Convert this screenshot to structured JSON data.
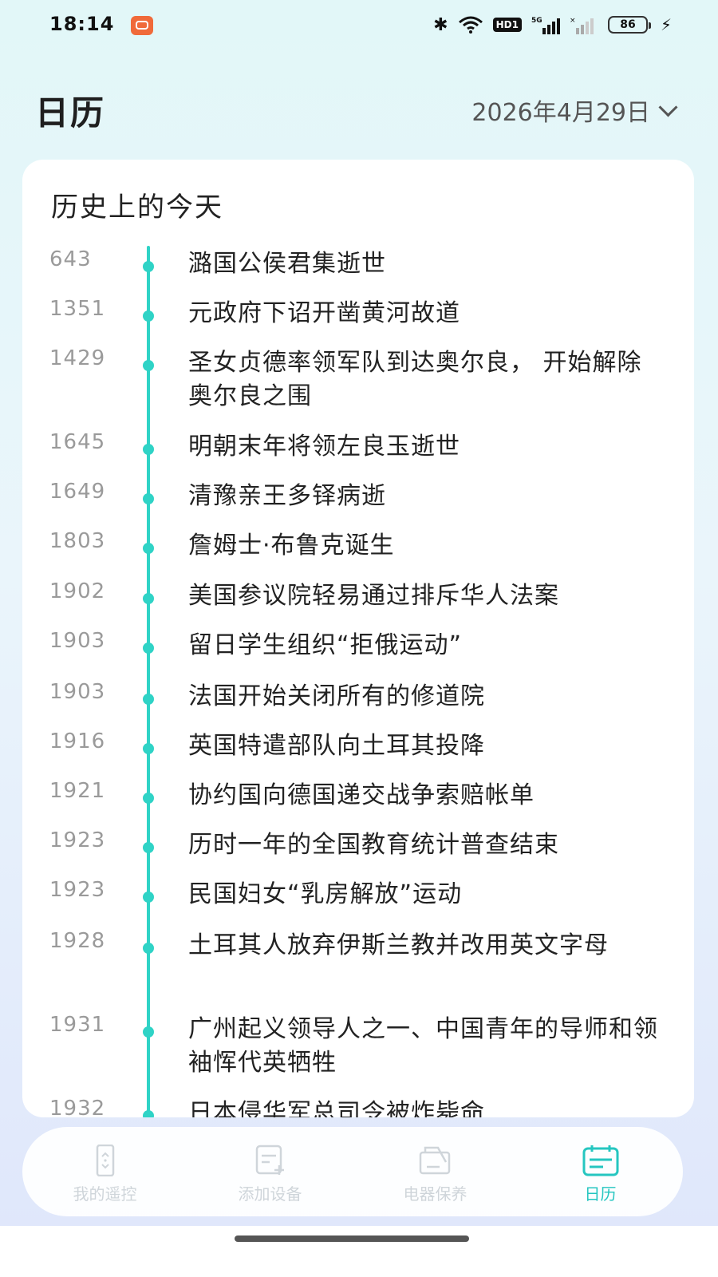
{
  "status": {
    "time": "18:14",
    "network": "5G",
    "hd": "HD1",
    "battery": "86"
  },
  "header": {
    "title": "日历",
    "date": "2026年4月29日"
  },
  "card": {
    "title": "历史上的今天",
    "events": [
      {
        "year": "643",
        "text": "潞国公侯君集逝世"
      },
      {
        "year": "1351",
        "text": "元政府下诏开凿黄河故道"
      },
      {
        "year": "1429",
        "text": "圣女贞德率领军队到达奥尔良， 开始解除奥尔良之围"
      },
      {
        "year": "1645",
        "text": "明朝末年将领左良玉逝世"
      },
      {
        "year": "1649",
        "text": "清豫亲王多铎病逝"
      },
      {
        "year": "1803",
        "text": "詹姆士·布鲁克诞生"
      },
      {
        "year": "1902",
        "text": "美国参议院轻易通过排斥华人法案"
      },
      {
        "year": "1903",
        "text": "留日学生组织“拒俄运动”"
      },
      {
        "year": "1903",
        "text": "法国开始关闭所有的修道院"
      },
      {
        "year": "1916",
        "text": "英国特遣部队向土耳其投降"
      },
      {
        "year": "1921",
        "text": "协约国向德国递交战争索赔帐单"
      },
      {
        "year": "1923",
        "text": "历时一年的全国教育统计普查结束"
      },
      {
        "year": "1923",
        "text": "民国妇女“乳房解放”运动"
      },
      {
        "year": "1928",
        "text": "土耳其人放弃伊斯兰教并改用英文字母"
      },
      {
        "year": "1931",
        "text": "广州起义领导人之一、中国青年的导师和领袖恽代英牺牲"
      },
      {
        "year": "1932",
        "text": "日本侵华军总司令被炸毙命"
      }
    ]
  },
  "nav": {
    "items": [
      {
        "label": "我的遥控",
        "icon": "remote-icon"
      },
      {
        "label": "添加设备",
        "icon": "add-device-icon"
      },
      {
        "label": "电器保养",
        "icon": "maintenance-icon"
      },
      {
        "label": "日历",
        "icon": "calendar-icon"
      }
    ],
    "active_color": "#25c6c0",
    "inactive_color": "#cfd5da"
  },
  "colors": {
    "timeline": "#2fd3c6"
  }
}
